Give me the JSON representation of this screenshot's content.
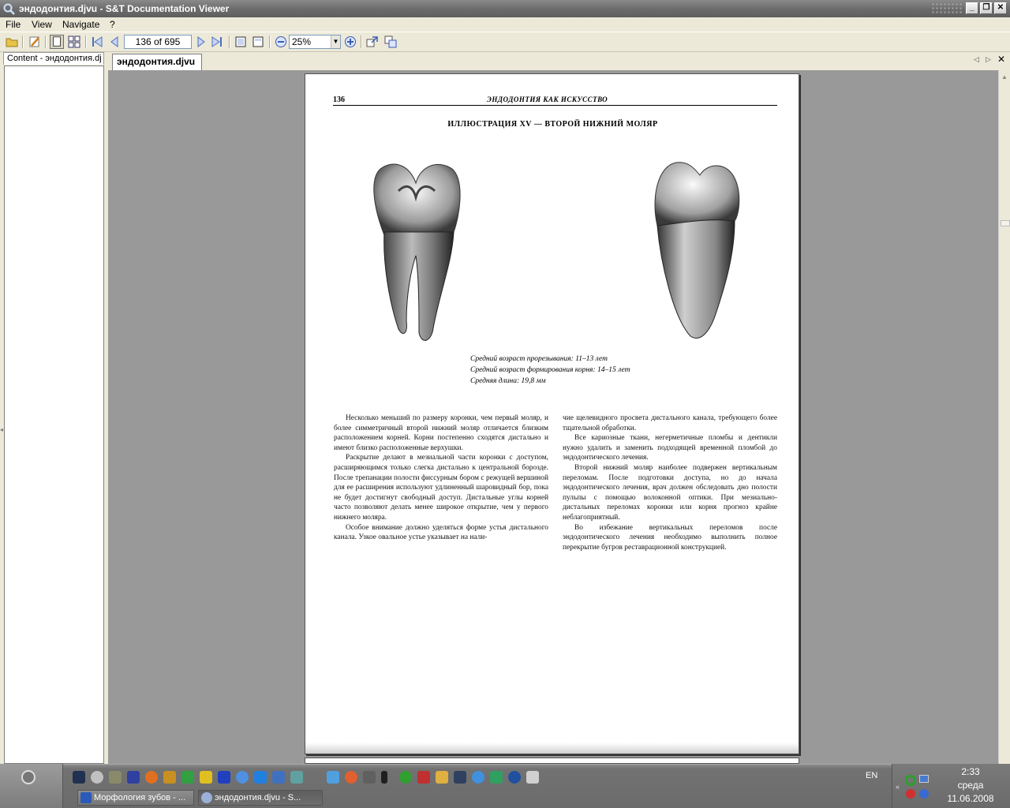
{
  "window": {
    "title": "эндодонтия.djvu - S&T Documentation Viewer"
  },
  "menu": [
    {
      "label": "File"
    },
    {
      "label": "View"
    },
    {
      "label": "Navigate"
    },
    {
      "label": "?"
    }
  ],
  "toolbar": {
    "page_indicator": "136 of 695",
    "zoom": "25%"
  },
  "sidebar": {
    "tab_label": "Content - эндодонтия.dj"
  },
  "document": {
    "tab_label": "эндодонтия.djvu"
  },
  "page": {
    "number": "136",
    "running_head": "ЭНДОДОНТИЯ  КАК  ИСКУССТВО",
    "illustration_title": "ИЛЛЮСТРАЦИЯ XV — ВТОРОЙ НИЖНИЙ МОЛЯР",
    "facts": [
      "Средний возраст прорезывания: 11–13 лет",
      "Средний возраст формирования корня: 14–15 лет",
      "Средняя длина: 19,8 мм"
    ],
    "col1": [
      "Несколько меньший по размеру коронки, чем первый моляр, и более симметричный второй нижний моляр отличается близким расположением корней. Корни постепенно сходятся дистально и имеют близко расположенные верхушки.",
      "Раскрытие делают в мезиальной части коронки с доступом, расширяющимся только слегка дистально к центральной борозде. После трепанации полости фиссурным бором с режущей вершиной для ее расширения используют удлиненный шаровидный бор, пока не будет достигнут свободный доступ. Дистальные углы корней часто позволяют делать менее широкое открытие, чем у первого нижнего моляра.",
      "Особое внимание должно уделяться форме устья дистального канала. Узкое овальное устье указывает на нали-"
    ],
    "col2_cont": "чие щелевидного просвета дистального канала, требующего более тщательной обработки.",
    "col2": [
      "Все кариозные ткани, негерметичные пломбы и дентикли нужно удалить и заменить подходящей временной пломбой до эндодонтического лечения.",
      "Второй нижний моляр наиболее подвержен вертикальным переломам. После подготовки доступа, но до начала эндодонтического лечения, врач должен обследовать дно полости пульпы с помощью волоконной оптики. При мезиально-дистальных переломах коронки или корня прогноз крайне неблагоприятный.",
      "Во избежание вертикальных переломов после эндодонтического лечения необходимо выполнить полное перекрытие бугров реставрационной конструкцией."
    ]
  },
  "taskbar": {
    "buttons": [
      {
        "label": "Морфология зубов - ..."
      },
      {
        "label": "эндодонтия.djvu - S..."
      }
    ],
    "language": "EN",
    "clock": {
      "time": "2:33",
      "day": "среда",
      "date": "11.06.2008"
    }
  }
}
